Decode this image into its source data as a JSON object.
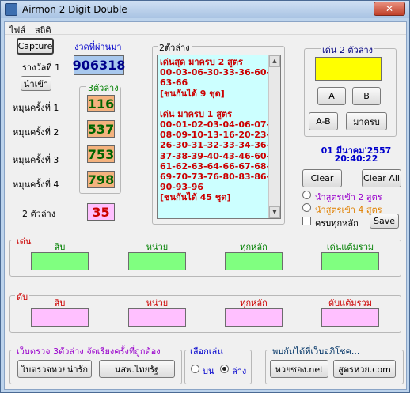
{
  "window": {
    "title": "Airmon 2 Digit Double",
    "close_glyph": "✕"
  },
  "menu": [
    "ไฟล์",
    "สถิติ"
  ],
  "capture_label": "Capture",
  "left": {
    "prize1_label": "รางวัลที่ 1",
    "import_label": "นำเข้า",
    "spin1": "หมุนครั้งที่ 1",
    "spin2": "หมุนครั้งที่ 2",
    "spin3": "หมุนครั้งที่ 3",
    "spin4": "หมุนครั้งที่ 4",
    "two_bottom_label": "2 ตัวล่าง"
  },
  "last_draw": {
    "caption": "งวดที่ผ่านมา",
    "value": "906318"
  },
  "three_bottom": {
    "caption": "3ตัวล่าง",
    "values": [
      "116",
      "537",
      "753",
      "798"
    ]
  },
  "two_bottom_value": "35",
  "two_digit_box": {
    "caption": "2ตัวล่าง",
    "lines": [
      "เด่นสุด มาครบ 2 สูตร",
      "00-03-06-30-33-36-60-",
      "63-66",
      "[ชนกันได้ 9 ชุด]",
      "",
      "เด่น มาครบ 1 สูตร",
      "00-01-02-03-04-06-07-",
      "08-09-10-13-16-20-23-",
      "26-30-31-32-33-34-36-",
      "37-38-39-40-43-46-60-",
      "61-62-63-64-66-67-68-",
      "69-70-73-76-80-83-86-",
      "90-93-96",
      "[ชนกันได้ 45 ชุด]"
    ]
  },
  "feature": {
    "caption": "เด่น 2 ตัวล่าง",
    "a": "A",
    "b": "B",
    "ab": "A-B",
    "complete": "มาครบ"
  },
  "datetime": {
    "date": "01 มีนาคม'2557",
    "time": "20:40:22"
  },
  "clear_label": "Clear",
  "clear_all_label": "Clear All",
  "radio_two": "นำสูตรเข้า 2 สูตร",
  "radio_four": "นำสูตรเข้า 4 สูตร",
  "check_all": "ครบทุกหลัก",
  "save_label": "Save",
  "colors": {
    "green_field": "#80ff80",
    "pink_field": "#ffc0ff",
    "yellow_box": "#ffff00",
    "red_text": "#cc0000",
    "blue_text": "#0000cc",
    "purple_text": "#9900cc",
    "orange_text": "#e08000"
  },
  "top_group": {
    "caption": "เด่น",
    "cols": [
      "สิบ",
      "หน่วย",
      "ทุกหลัก",
      "เด่นแต้มรวม"
    ]
  },
  "bottom_group": {
    "caption": "ดับ",
    "cols": [
      "สิบ",
      "หน่วย",
      "ทุกหลัก",
      "ดับแต้มรวม"
    ]
  },
  "browse": {
    "caption": "เว็บตรวจ 3ตัวล่าง จัดเรียงครั้งที่ถูกต้อง",
    "btn1": "ใบตรวจหวยน่ารัก",
    "btn2": "นสพ.ไทยรัฐ"
  },
  "choose": {
    "caption": "เลือกเล่น",
    "top": "บน",
    "bottom": "ล่าง"
  },
  "meet": {
    "caption": "พบกันได้ที่เว็บอภิโชค...",
    "btn1": "หวยซอง.net",
    "btn2": "สูตรหวย.com"
  }
}
